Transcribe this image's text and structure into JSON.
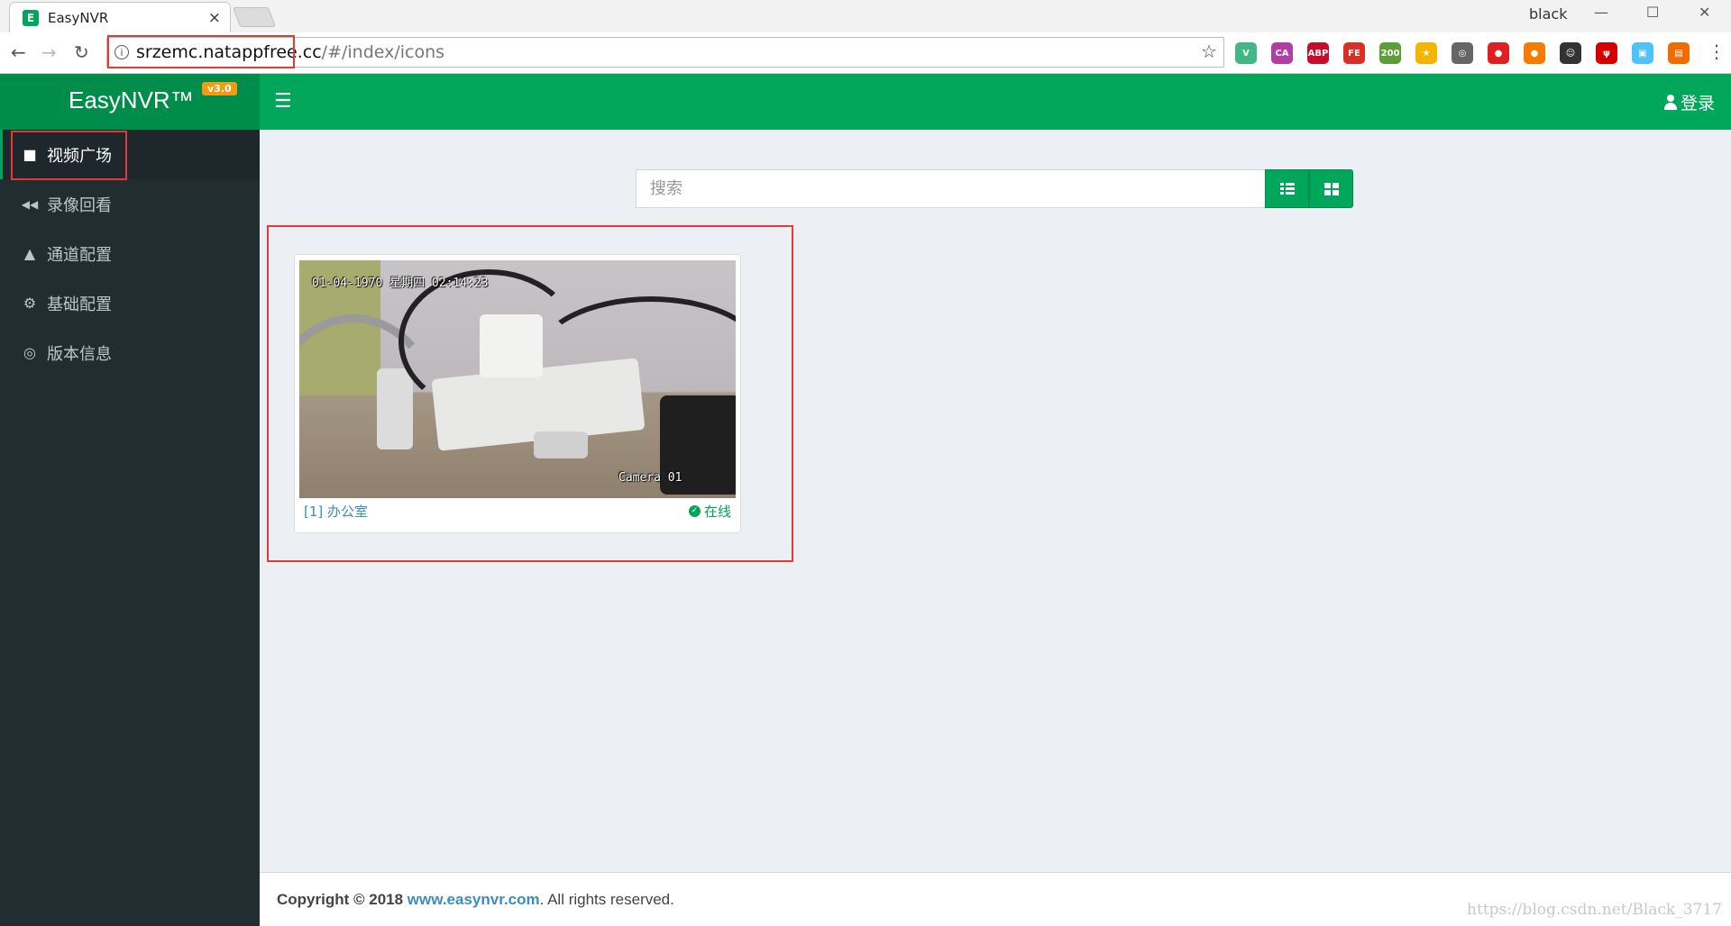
{
  "browser": {
    "tab_title": "EasyNVR",
    "tab_favicon": "E",
    "close_glyph": "×",
    "profile_name": "black",
    "url_host": "srzemc.natappfree.cc",
    "url_path": "/#/index/icons",
    "extensions": [
      {
        "label": "V",
        "color": "#41b883"
      },
      {
        "label": "CA",
        "color": "#b23ea5"
      },
      {
        "label": "ABP",
        "color": "#c70d2c"
      },
      {
        "label": "FE",
        "color": "#d93025"
      },
      {
        "label": "200",
        "color": "#5b9e3a"
      },
      {
        "label": "★",
        "color": "#f4b400"
      },
      {
        "label": "◎",
        "color": "#666666"
      },
      {
        "label": "●",
        "color": "#e02020"
      },
      {
        "label": "●",
        "color": "#f57c00"
      },
      {
        "label": "☺",
        "color": "#333333"
      },
      {
        "label": "ψ",
        "color": "#d50000"
      },
      {
        "label": "▣",
        "color": "#4fc3f7"
      },
      {
        "label": "▤",
        "color": "#ef6c00"
      }
    ]
  },
  "header": {
    "logo": "EasyNVR™",
    "version": "v3.0",
    "login_label": "登录"
  },
  "sidebar": {
    "items": [
      {
        "label": "视频广场",
        "icon": "video-camera-icon",
        "glyph": "■"
      },
      {
        "label": "录像回看",
        "icon": "backward-icon",
        "glyph": "◀◀"
      },
      {
        "label": "通道配置",
        "icon": "road-icon",
        "glyph": "▲"
      },
      {
        "label": "基础配置",
        "icon": "cogs-icon",
        "glyph": "⚙"
      },
      {
        "label": "版本信息",
        "icon": "life-ring-icon",
        "glyph": "◎"
      }
    ]
  },
  "search": {
    "placeholder": "搜索"
  },
  "cameras": [
    {
      "name": "[1] 办公室",
      "status": "在线",
      "osd_top": "01-04-1970 星期四 02:14:23",
      "osd_bottom": "Camera 01"
    }
  ],
  "footer": {
    "copyright_prefix": "Copyright © 2018",
    "link_text": "www.easynvr.com",
    "suffix": ". All rights reserved."
  },
  "watermark": "https://blog.csdn.net/Black_3717",
  "colors": {
    "brand_green": "#00a65a",
    "sidebar_bg": "#222d32",
    "highlight_red": "#e53935",
    "link_blue": "#3c8dbc"
  }
}
